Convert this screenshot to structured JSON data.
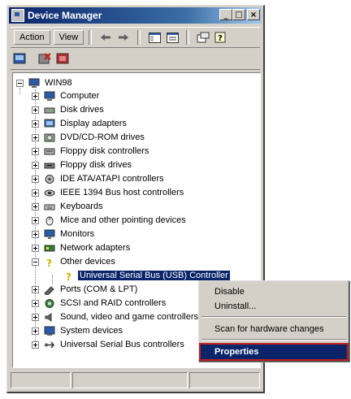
{
  "window": {
    "title": "Device Manager",
    "caption_buttons": {
      "minimize": "_",
      "maximize": "□",
      "close": "×"
    }
  },
  "menu": {
    "action": "Action",
    "view": "View"
  },
  "toolbar": {
    "icons": [
      "back-arrow-icon",
      "forward-arrow-icon",
      "show-hide-tree-icon",
      "properties-icon",
      "refresh-icon",
      "help-icon"
    ]
  },
  "toolbar2": {
    "icons": [
      "scan-hardware-icon",
      "uninstall-icon",
      "disable-icon"
    ]
  },
  "tree": {
    "root": "WIN98",
    "categories": [
      "Computer",
      "Disk drives",
      "Display adapters",
      "DVD/CD-ROM drives",
      "Floppy disk controllers",
      "Floppy disk drives",
      "IDE ATA/ATAPI controllers",
      "IEEE 1394 Bus host controllers",
      "Keyboards",
      "Mice and other pointing devices",
      "Monitors",
      "Network adapters",
      "Other devices",
      "Ports (COM & LPT)",
      "SCSI and RAID controllers",
      "Sound, video and game controllers",
      "System devices",
      "Universal Serial Bus controllers"
    ],
    "selected_device": "Universal Serial Bus (USB) Controller"
  },
  "context_menu": {
    "disable": "Disable",
    "uninstall": "Uninstall...",
    "scan": "Scan for hardware changes",
    "properties": "Properties"
  },
  "colors": {
    "title_bar": "#0a246a",
    "highlight": "#0a246a",
    "outline": "#c42020",
    "face": "#d4d0c8"
  }
}
